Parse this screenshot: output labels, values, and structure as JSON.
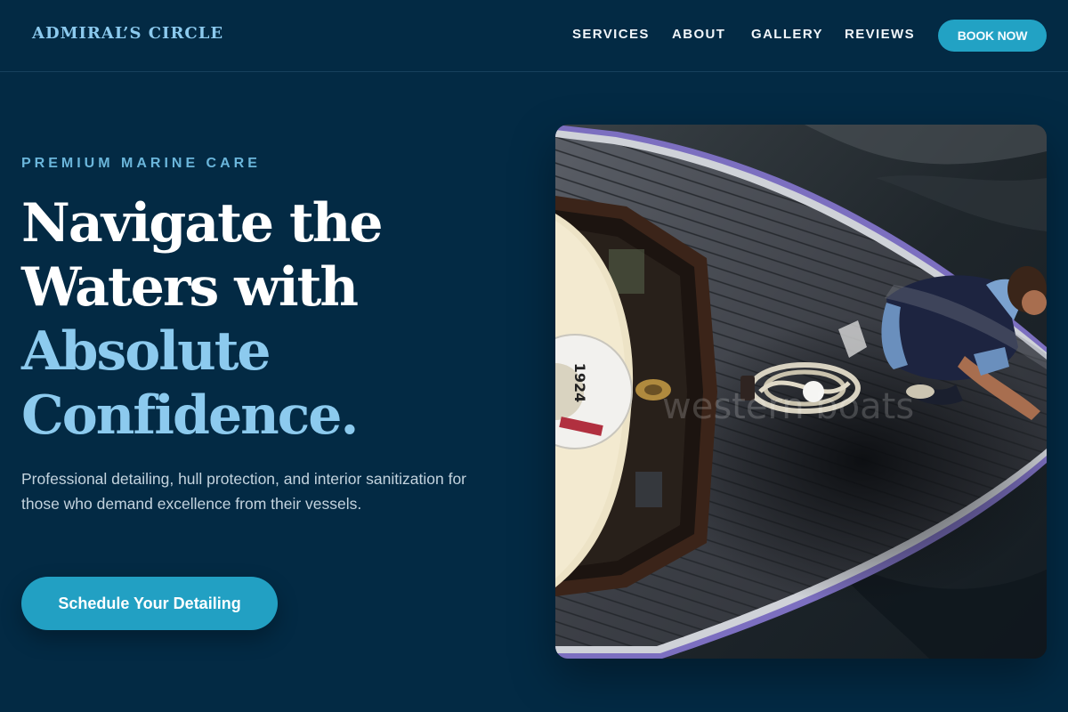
{
  "brand": {
    "name": "ADMIRAL’S CIRCLE"
  },
  "nav": {
    "items": [
      {
        "label": "SERVICES"
      },
      {
        "label": "ABOUT"
      },
      {
        "label": "GALLERY"
      },
      {
        "label": "REVIEWS"
      }
    ],
    "cta_label": "BOOK NOW"
  },
  "hero": {
    "eyebrow": "PREMIUM MARINE CARE",
    "headline": {
      "line1": "Navigate the",
      "line2": "Waters with",
      "line3": "Absolute",
      "line4": "Confidence."
    },
    "subtitle": "Professional detailing, hull protection, and interior sanitization for those who demand excellence from their vessels.",
    "cta_label": "Schedule Your Detailing",
    "image": {
      "subject": "aerial view of wooden boat bow with man on deck",
      "life_ring_text": "1924",
      "watermark": "western boats"
    }
  },
  "colors": {
    "background": "#032a44",
    "accent": "#22a2c4",
    "light_blue": "#8ccaee",
    "eyebrow": "#6bb6db",
    "subtitle": "#c3d3de",
    "headline": "#ffffff"
  }
}
